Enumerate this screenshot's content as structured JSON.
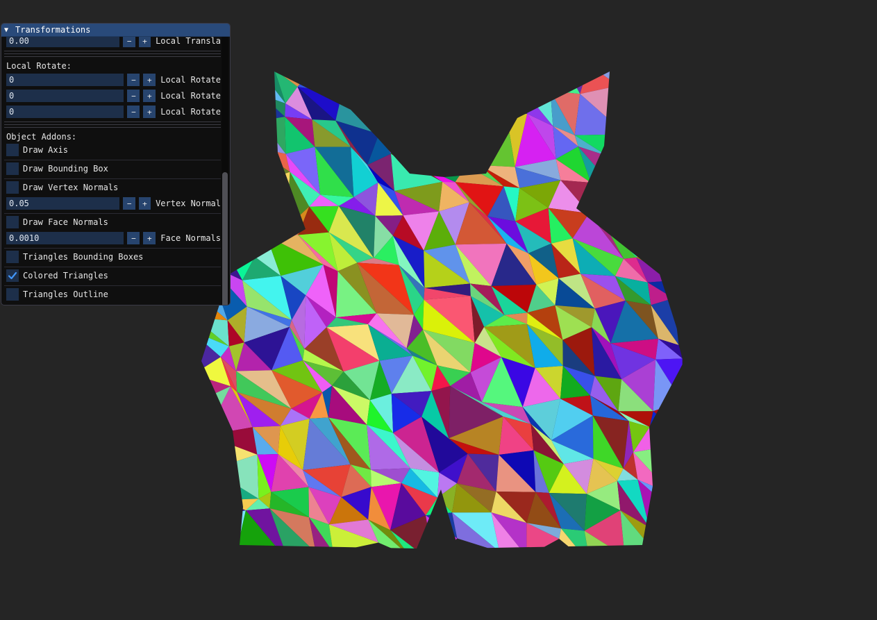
{
  "window": {
    "title": "Transformations",
    "collapse_arrow": "▼"
  },
  "translate": {
    "value": "0.00",
    "label": "Local Transla"
  },
  "rotate": {
    "section": "Local Rotate:",
    "rows": [
      {
        "value": "0",
        "label": "Local Rotate"
      },
      {
        "value": "0",
        "label": "Local Rotate"
      },
      {
        "value": "0",
        "label": "Local Rotate"
      }
    ]
  },
  "stepper": {
    "minus": "−",
    "plus": "+"
  },
  "addons": {
    "section": "Object Addons:",
    "draw_axis": {
      "label": "Draw Axis",
      "checked": false
    },
    "draw_bbox": {
      "label": "Draw Bounding Box",
      "checked": false
    },
    "draw_vertex_normals": {
      "label": "Draw Vertex Normals",
      "checked": false
    },
    "vertex_normal_len": {
      "value": "0.05",
      "label": "Vertex Normal"
    },
    "draw_face_normals": {
      "label": "Draw Face Normals",
      "checked": false
    },
    "face_normal_len": {
      "value": "0.0010",
      "label": "Face Normals"
    },
    "tri_bboxes": {
      "label": "Triangles Bounding Boxes",
      "checked": false
    },
    "colored_tris": {
      "label": "Colored Triangles",
      "checked": true
    },
    "tri_outline": {
      "label": "Triangles Outline",
      "checked": false
    }
  },
  "colors": {
    "background": "#252525",
    "title_bar": "#294a7a",
    "field": "#1d2f4a",
    "button": "#27446e",
    "check": "#4296fa"
  },
  "icons": {
    "collapse": "triangle-down-icon",
    "check": "checkmark-icon"
  }
}
